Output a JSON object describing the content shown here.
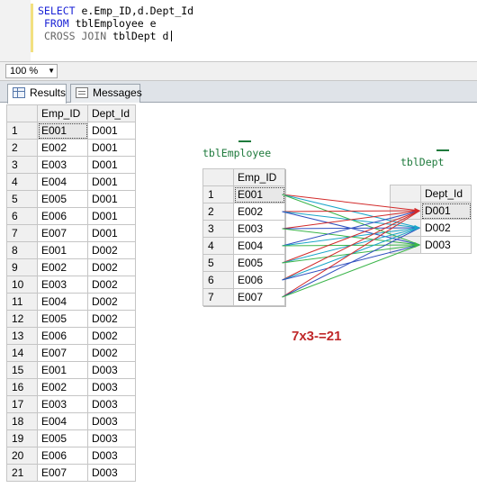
{
  "editor": {
    "line1": {
      "kw": "SELECT",
      "rest": " e.Emp_ID,d.Dept_Id"
    },
    "line2": {
      "kw": "FROM",
      "rest": " tblEmployee e"
    },
    "line3": {
      "kw": "CROSS JOIN",
      "rest": " tblDept d"
    }
  },
  "zoom": {
    "value": "100 %"
  },
  "tabs": {
    "results": "Results",
    "messages": "Messages"
  },
  "results": {
    "headers": [
      "Emp_ID",
      "Dept_Id"
    ],
    "rows": [
      [
        "1",
        "E001",
        "D001"
      ],
      [
        "2",
        "E002",
        "D001"
      ],
      [
        "3",
        "E003",
        "D001"
      ],
      [
        "4",
        "E004",
        "D001"
      ],
      [
        "5",
        "E005",
        "D001"
      ],
      [
        "6",
        "E006",
        "D001"
      ],
      [
        "7",
        "E007",
        "D001"
      ],
      [
        "8",
        "E001",
        "D002"
      ],
      [
        "9",
        "E002",
        "D002"
      ],
      [
        "10",
        "E003",
        "D002"
      ],
      [
        "11",
        "E004",
        "D002"
      ],
      [
        "12",
        "E005",
        "D002"
      ],
      [
        "13",
        "E006",
        "D002"
      ],
      [
        "14",
        "E007",
        "D002"
      ],
      [
        "15",
        "E001",
        "D003"
      ],
      [
        "16",
        "E002",
        "D003"
      ],
      [
        "17",
        "E003",
        "D003"
      ],
      [
        "18",
        "E004",
        "D003"
      ],
      [
        "19",
        "E005",
        "D003"
      ],
      [
        "20",
        "E006",
        "D003"
      ],
      [
        "21",
        "E007",
        "D003"
      ]
    ]
  },
  "employee_table": {
    "label": "tblEmployee",
    "header": "Emp_ID",
    "rows": [
      [
        "1",
        "E001"
      ],
      [
        "2",
        "E002"
      ],
      [
        "3",
        "E003"
      ],
      [
        "4",
        "E004"
      ],
      [
        "5",
        "E005"
      ],
      [
        "6",
        "E006"
      ],
      [
        "7",
        "E007"
      ]
    ]
  },
  "dept_table": {
    "label": "tblDept",
    "header": "Dept_Id",
    "rows": [
      "D001",
      "D002",
      "D003"
    ]
  },
  "formula": "7x3-=21",
  "link_colors": {
    "to_D001": "#d22a2a",
    "to_D002": "#1aa5c8",
    "to_D003": "#3bb54a",
    "mixed": "#2f4fbf"
  }
}
